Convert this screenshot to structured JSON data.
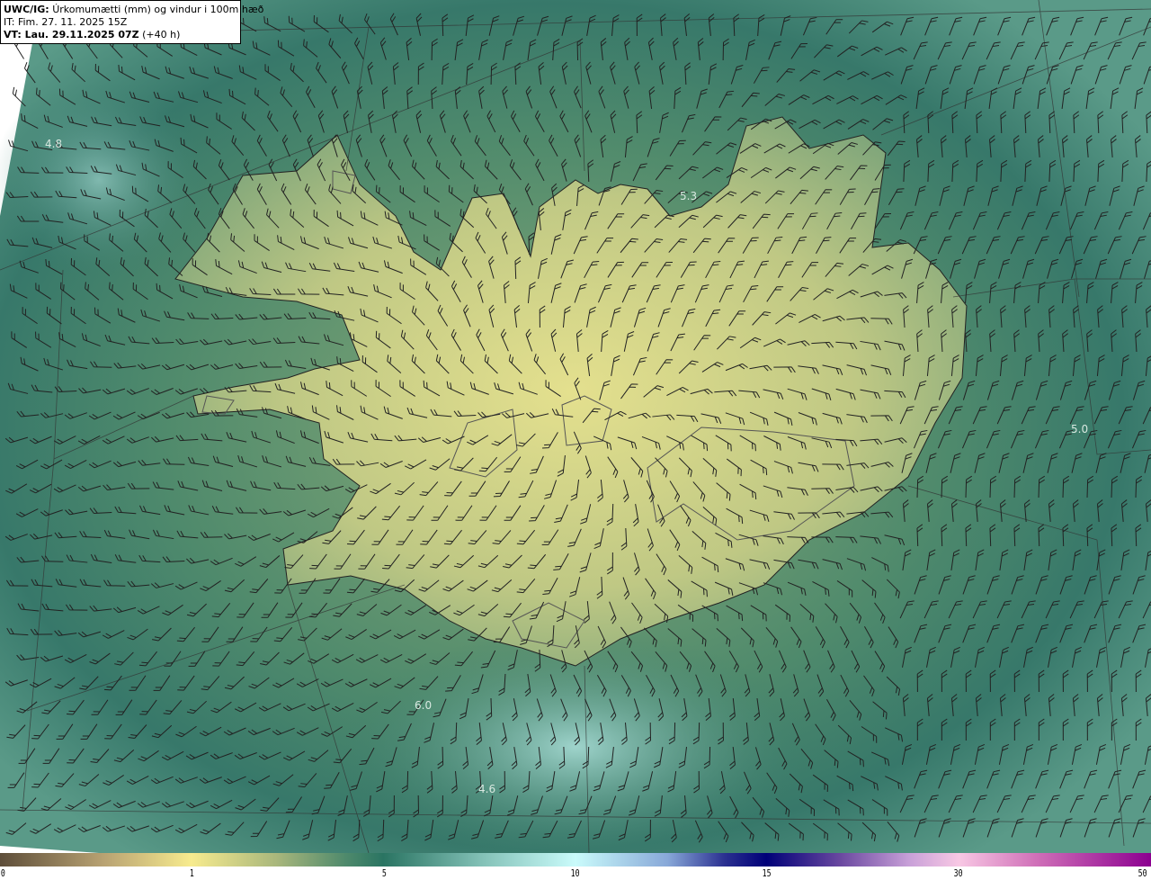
{
  "header": {
    "product": "UWC/IG:",
    "description": "Úrkomumætti (mm) og vindur i 100m hæð",
    "initial_time": "IT: Fim. 27. 11. 2025 15Z",
    "valid_label": "VT: Lau. 29.11.2025 07Z",
    "lead": "(+40 h)"
  },
  "map_labels": [
    "4.8",
    "5.3",
    "5.0",
    "6.0",
    "4.6"
  ],
  "colorbar": {
    "ticks": [
      "0",
      "1",
      "5",
      "10",
      "15",
      "30",
      "50"
    ],
    "colors": {
      "0": "#5e4e3a",
      "1": "#f7eb8e",
      "5": "#2a7462",
      "10": "#cafbfb",
      "15": "#000078",
      "30": "#f8c8e4",
      "50": "#8c0090"
    }
  }
}
